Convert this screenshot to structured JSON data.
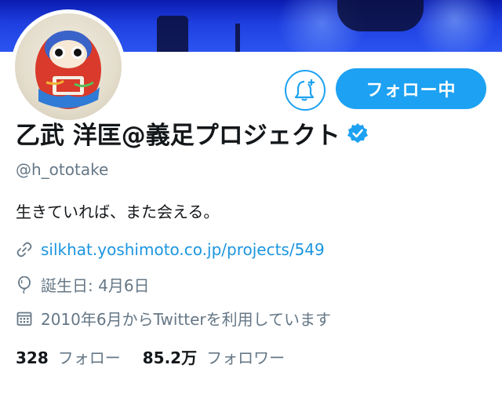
{
  "profile": {
    "name": "乙武 洋匡@義足プロジェクト",
    "handle": "@h_ototake",
    "bio": "生きていれば、また会える。",
    "link": "silkhat.yoshimoto.co.jp/projects/549",
    "birthday": "誕生日: 4月6日",
    "joined": "2010年6月からTwitterを利用しています"
  },
  "actions": {
    "follow_label": "フォロー中"
  },
  "stats": {
    "following_count": "328",
    "following_label": "フォロー",
    "followers_count": "85.2万",
    "followers_label": "フォロワー"
  },
  "colors": {
    "accent": "#1da1f2",
    "link": "#1b95e0",
    "secondary_text": "#657786",
    "primary_text": "#14171a"
  },
  "icons": [
    "notification-bell-plus-icon",
    "verified-badge-icon",
    "link-icon",
    "balloon-icon",
    "calendar-icon"
  ]
}
